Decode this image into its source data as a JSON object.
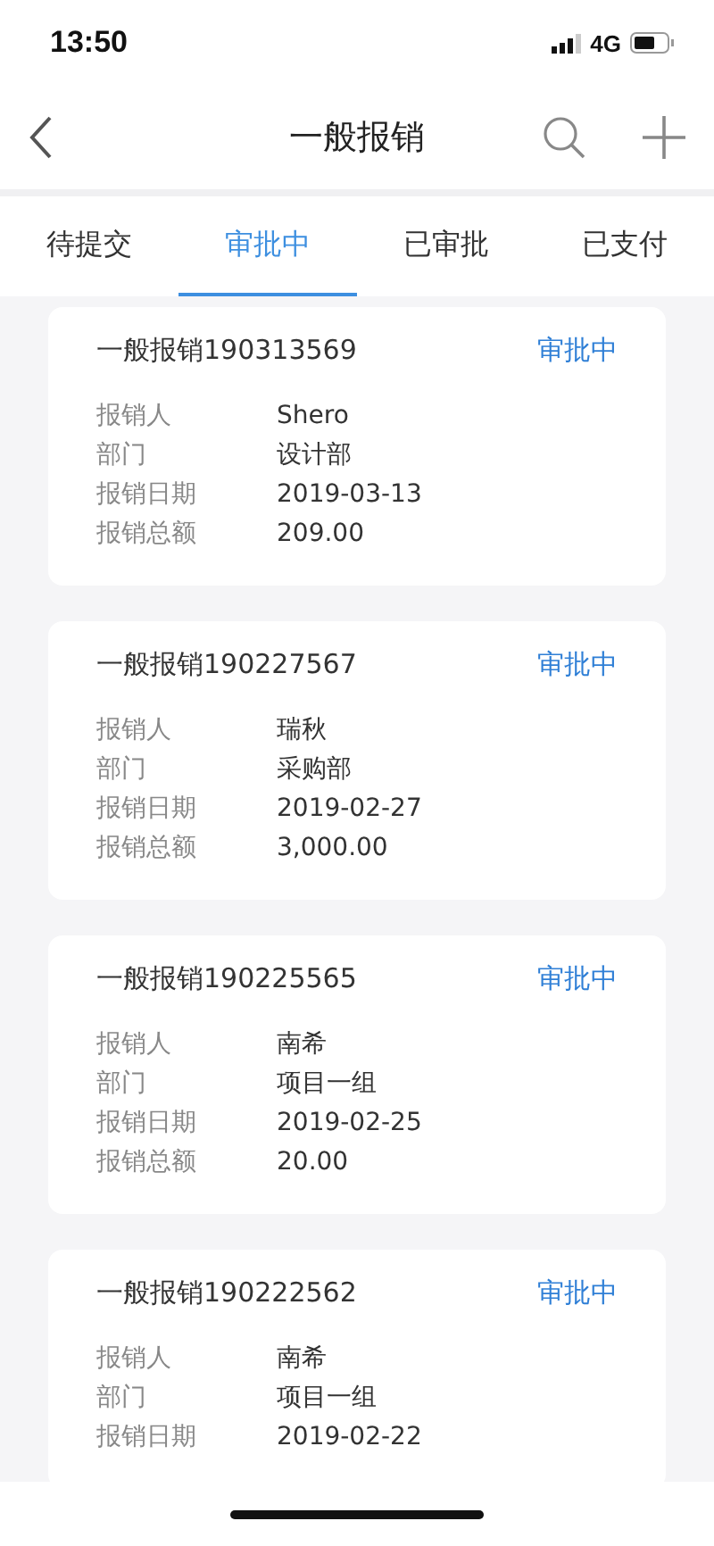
{
  "status_bar": {
    "time": "13:50",
    "network": "4G"
  },
  "header": {
    "title": "一般报销"
  },
  "tabs": [
    {
      "label": "待提交",
      "selected": false
    },
    {
      "label": "审批中",
      "selected": true
    },
    {
      "label": "已审批",
      "selected": false
    },
    {
      "label": "已支付",
      "selected": false
    }
  ],
  "cards": [
    {
      "title": "一般报销190313569",
      "status": "审批中",
      "fields": [
        {
          "label": "报销人",
          "value": "Shero"
        },
        {
          "label": "部门",
          "value": "设计部"
        },
        {
          "label": "报销日期",
          "value": "2019-03-13"
        },
        {
          "label": "报销总额",
          "value": "209.00"
        }
      ]
    },
    {
      "title": "一般报销190227567",
      "status": "审批中",
      "fields": [
        {
          "label": "报销人",
          "value": "瑞秋"
        },
        {
          "label": "部门",
          "value": "采购部"
        },
        {
          "label": "报销日期",
          "value": "2019-02-27"
        },
        {
          "label": "报销总额",
          "value": "3,000.00"
        }
      ]
    },
    {
      "title": "一般报销190225565",
      "status": "审批中",
      "fields": [
        {
          "label": "报销人",
          "value": "南希"
        },
        {
          "label": "部门",
          "value": "项目一组"
        },
        {
          "label": "报销日期",
          "value": "2019-02-25"
        },
        {
          "label": "报销总额",
          "value": "20.00"
        }
      ]
    },
    {
      "title": "一般报销190222562",
      "status": "审批中",
      "fields": [
        {
          "label": "报销人",
          "value": "南希"
        },
        {
          "label": "部门",
          "value": "项目一组"
        },
        {
          "label": "报销日期",
          "value": "2019-02-22"
        }
      ]
    }
  ]
}
